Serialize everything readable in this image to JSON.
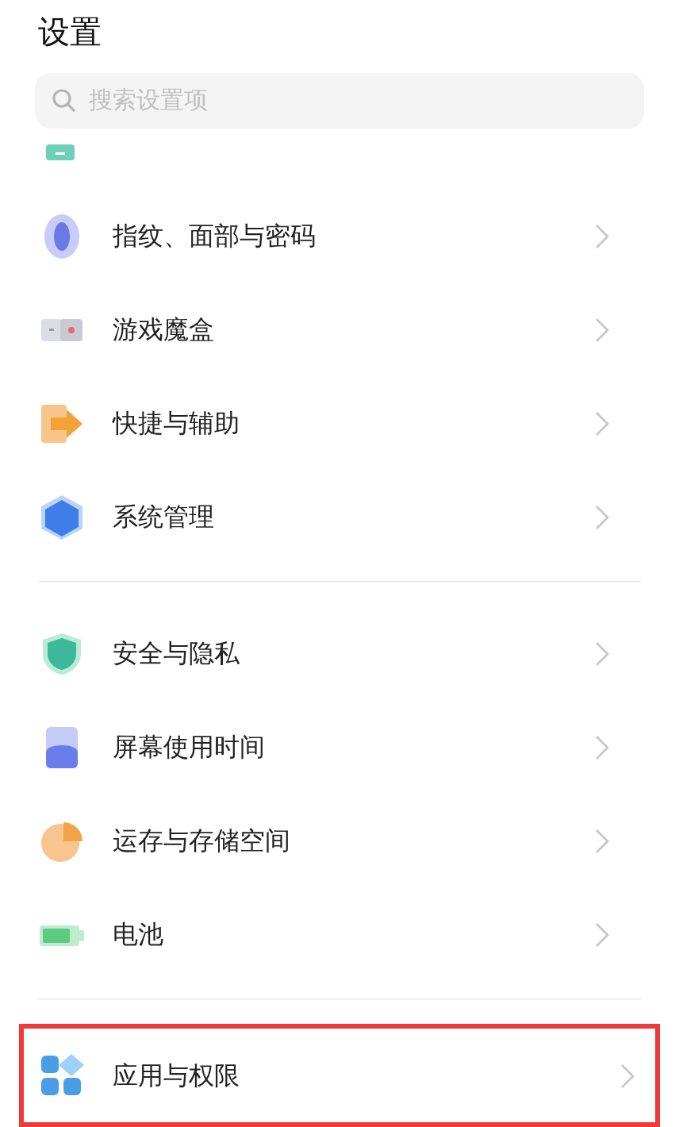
{
  "title": "设置",
  "search": {
    "placeholder": "搜索设置项"
  },
  "groups": [
    {
      "items": [
        {
          "label": "指纹、面部与密码",
          "kind": "fingerprint",
          "highlighted": false
        },
        {
          "label": "游戏魔盒",
          "kind": "gamebox",
          "highlighted": false
        },
        {
          "label": "快捷与辅助",
          "kind": "shortcut",
          "highlighted": false
        },
        {
          "label": "系统管理",
          "kind": "hexagon",
          "highlighted": false
        }
      ]
    },
    {
      "items": [
        {
          "label": "安全与隐私",
          "kind": "shield",
          "highlighted": false
        },
        {
          "label": "屏幕使用时间",
          "kind": "screentime",
          "highlighted": false
        },
        {
          "label": "运存与存储空间",
          "kind": "pie",
          "highlighted": false
        },
        {
          "label": "电池",
          "kind": "battery",
          "highlighted": false
        }
      ]
    },
    {
      "items": [
        {
          "label": "应用与权限",
          "kind": "apps",
          "highlighted": true
        }
      ]
    }
  ]
}
